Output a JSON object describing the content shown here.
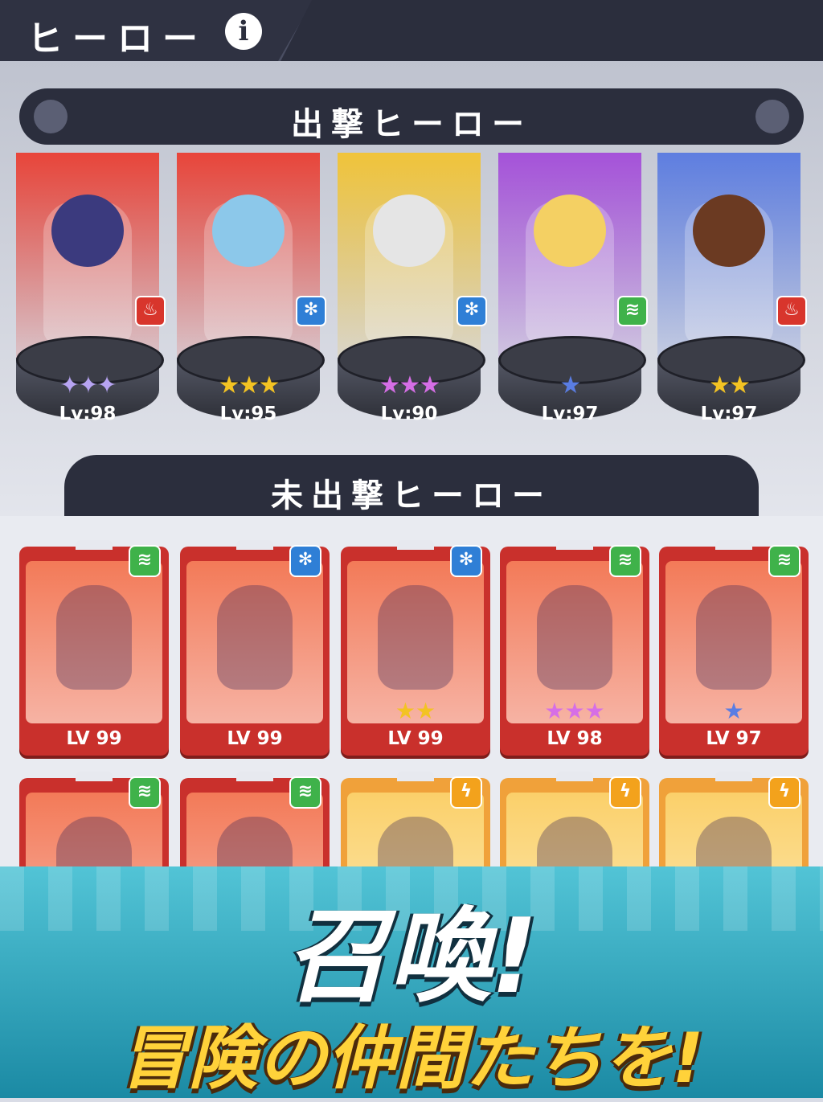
{
  "header": {
    "title": "ヒーロー",
    "info_icon": "info-icon"
  },
  "deployed": {
    "heading": "出撃ヒーロー",
    "heroes": [
      {
        "level": "Lv:98",
        "stars": "✦✦✦",
        "star_color": "#b7a4f2",
        "element": "fire",
        "bg": "#e8453a",
        "head": "#3b3a7e"
      },
      {
        "level": "Lv:95",
        "stars": "★★★",
        "star_color": "#f3c323",
        "element": "ice",
        "bg": "#e8453a",
        "head": "#8cc8ea"
      },
      {
        "level": "Lv:90",
        "stars": "★★★",
        "star_color": "#d66ee6",
        "element": "ice",
        "bg": "#f0c43a",
        "head": "#e5e5e5"
      },
      {
        "level": "Lv:97",
        "stars": "★",
        "star_color": "#5a7de3",
        "element": "wind",
        "bg": "#a552d9",
        "head": "#f4d063"
      },
      {
        "level": "Lv:97",
        "stars": "★★",
        "star_color": "#f3c323",
        "element": "fire",
        "bg": "#5e7ee0",
        "head": "#6b3a22"
      }
    ]
  },
  "reserve": {
    "heading": "未出撃ヒーロー",
    "cards": [
      {
        "level": "LV 99",
        "stars": "",
        "star_color": "#f3c323",
        "element": "wind",
        "gold": false
      },
      {
        "level": "LV 99",
        "stars": "",
        "star_color": "#f3c323",
        "element": "ice",
        "gold": false
      },
      {
        "level": "LV 99",
        "stars": "★★",
        "star_color": "#f3c323",
        "element": "ice",
        "gold": false
      },
      {
        "level": "LV 98",
        "stars": "★★★",
        "star_color": "#d66ee6",
        "element": "wind",
        "gold": false
      },
      {
        "level": "LV 97",
        "stars": "★",
        "star_color": "#5a7de3",
        "element": "wind",
        "gold": false
      },
      {
        "level": "",
        "stars": "",
        "star_color": "#f3c323",
        "element": "wind",
        "gold": false
      },
      {
        "level": "",
        "stars": "",
        "star_color": "#f3c323",
        "element": "wind",
        "gold": false
      },
      {
        "level": "",
        "stars": "",
        "star_color": "#f3c323",
        "element": "bolt",
        "gold": true
      },
      {
        "level": "",
        "stars": "",
        "star_color": "#f3c323",
        "element": "bolt",
        "gold": true
      },
      {
        "level": "",
        "stars": "",
        "star_color": "#f3c323",
        "element": "bolt",
        "gold": true
      }
    ]
  },
  "promo": {
    "headline": "召喚!",
    "subline": "冒険の仲間たちを!"
  },
  "element_icons": {
    "fire": "♨",
    "ice": "✻",
    "wind": "≋",
    "bolt": "ϟ"
  }
}
